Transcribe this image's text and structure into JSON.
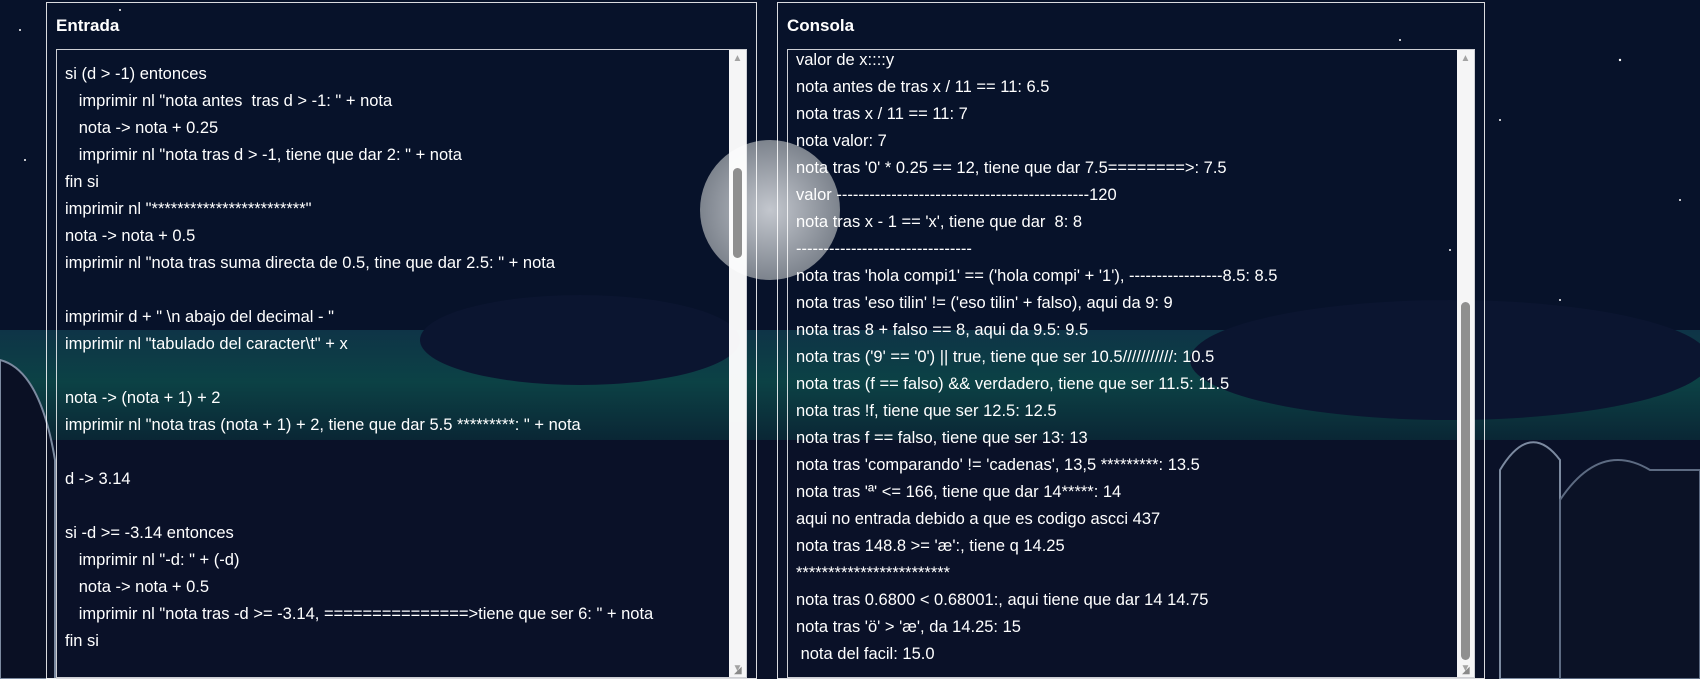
{
  "entrada": {
    "title": "Entrada",
    "lines": [
      "si (d > -1) entonces",
      "   imprimir nl \"nota antes  tras d > -1: \" + nota",
      "   nota -> nota + 0.25",
      "   imprimir nl \"nota tras d > -1, tiene que dar 2: \" + nota",
      "fin si",
      "imprimir nl \"************************\"",
      "nota -> nota + 0.5",
      "imprimir nl \"nota tras suma directa de 0.5, tine que dar 2.5: \" + nota",
      "",
      "imprimir d + \" \\n abajo del decimal - \"",
      "imprimir nl \"tabulado del caracter\\t\" + x",
      "",
      "nota -> (nota + 1) + 2",
      "imprimir nl \"nota tras (nota + 1) + 2, tiene que dar 5.5 *********: \" + nota",
      "",
      "d -> 3.14",
      "",
      "si -d >= -3.14 entonces",
      "   imprimir nl \"-d: \" + (-d)",
      "   nota -> nota + 0.5",
      "   imprimir nl \"nota tras -d >= -3.14, ===============>tiene que ser 6: \" + nota",
      "fin si"
    ],
    "scroll_position": 0.2
  },
  "consola": {
    "title": "Consola",
    "lines": [
      "valor de x::::y",
      "nota antes de tras x / 11 == 11: 6.5",
      "nota tras x / 11 == 11: 7",
      "nota valor: 7",
      "nota tras '0' * 0.25 == 12, tiene que dar 7.5========>: 7.5",
      "valor ----------------------------------------------120",
      "nota tras x - 1 == 'x', tiene que dar  8: 8",
      "--------------------------------",
      "nota tras 'hola compi1' == ('hola compi' + '1'), -----------------8.5: 8.5",
      "nota tras 'eso tilin' != ('eso tilin' + falso), aqui da 9: 9",
      "nota tras 8 + falso == 8, aqui da 9.5: 9.5",
      "nota tras ('9' == '0') || true, tiene que ser 10.5///////////: 10.5",
      "nota tras (f == falso) && verdadero, tiene que ser 11.5: 11.5",
      "nota tras !f, tiene que ser 12.5: 12.5",
      "nota tras f == falso, tiene que ser 13: 13",
      "nota tras 'comparando' != 'cadenas', 13,5 *********: 13.5",
      "nota tras 'ª' <= 166, tiene que dar 14*****: 14",
      "aqui no entrada debido a que es codigo ascci 437",
      "nota tras 148.8 >= 'æ':, tiene q 14.25",
      "************************",
      "nota tras 0.6800 < 0.68001:, aqui tiene que dar 14 14.75",
      "nota tras 'ö' > 'æ', da 14.25: 15",
      " nota del facil: 15.0"
    ],
    "scroll_position": 1.0
  }
}
